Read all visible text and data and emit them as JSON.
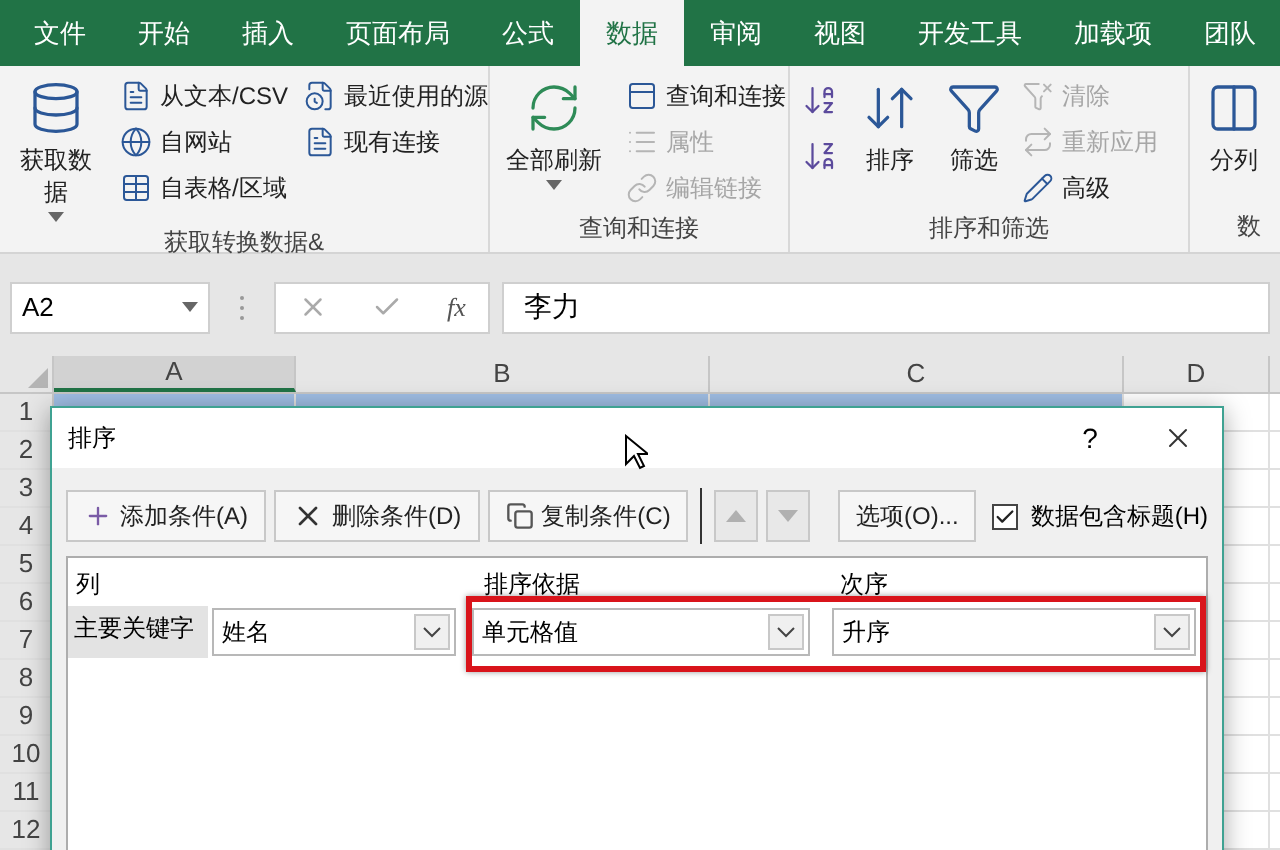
{
  "tabs": [
    {
      "label": "文件",
      "selected": false
    },
    {
      "label": "开始",
      "selected": false
    },
    {
      "label": "插入",
      "selected": false
    },
    {
      "label": "页面布局",
      "selected": false
    },
    {
      "label": "公式",
      "selected": false
    },
    {
      "label": "数据",
      "selected": true
    },
    {
      "label": "审阅",
      "selected": false
    },
    {
      "label": "视图",
      "selected": false
    },
    {
      "label": "开发工具",
      "selected": false
    },
    {
      "label": "加载项",
      "selected": false
    },
    {
      "label": "团队",
      "selected": false
    }
  ],
  "ribbon": {
    "groups": [
      {
        "label": "获取转换数据&",
        "columns": [
          [
            {
              "kind": "large",
              "label": "获取数据",
              "dropdown": true,
              "disabled": false
            }
          ],
          [
            {
              "kind": "small",
              "label": "从文本/CSV",
              "disabled": false
            },
            {
              "kind": "small",
              "label": "自网站",
              "disabled": false
            },
            {
              "kind": "small",
              "label": "自表格/区域",
              "disabled": false
            }
          ],
          [
            {
              "kind": "small",
              "label": "最近使用的源",
              "disabled": false
            },
            {
              "kind": "small",
              "label": "现有连接",
              "disabled": false
            }
          ]
        ]
      },
      {
        "label": "查询和连接",
        "columns": [
          [
            {
              "kind": "large",
              "label": "全部刷新",
              "dropdown": true,
              "disabled": false
            }
          ],
          [
            {
              "kind": "small",
              "label": "查询和连接",
              "disabled": false
            },
            {
              "kind": "small",
              "label": "属性",
              "disabled": true
            },
            {
              "kind": "small",
              "label": "编辑链接",
              "disabled": true
            }
          ]
        ]
      },
      {
        "label": "排序和筛选",
        "columns": [
          [
            {
              "kind": "icon",
              "disabled": false
            },
            {
              "kind": "icon",
              "disabled": false
            }
          ],
          [
            {
              "kind": "large",
              "label": "排序",
              "dropdown": false,
              "disabled": false
            }
          ],
          [
            {
              "kind": "large",
              "label": "筛选",
              "dropdown": false,
              "disabled": false
            }
          ],
          [
            {
              "kind": "small",
              "label": "清除",
              "disabled": true
            },
            {
              "kind": "small",
              "label": "重新应用",
              "disabled": true
            },
            {
              "kind": "small",
              "label": "高级",
              "disabled": false
            }
          ]
        ]
      },
      {
        "label": "数",
        "columns": [
          [
            {
              "kind": "large",
              "label": "分列",
              "dropdown": false,
              "disabled": false
            }
          ]
        ]
      }
    ]
  },
  "formula_bar": {
    "name_box": "A2",
    "function_label": "fx",
    "value": "李力"
  },
  "sheet": {
    "columns": [
      {
        "label": "A",
        "selected": true
      },
      {
        "label": "B",
        "selected": false
      },
      {
        "label": "C",
        "selected": false
      },
      {
        "label": "D",
        "selected": false
      }
    ],
    "rows": [
      "1",
      "2",
      "3",
      "4",
      "5",
      "6",
      "7",
      "8",
      "9",
      "10",
      "11",
      "12"
    ]
  },
  "dialog": {
    "title": "排序",
    "help": "?",
    "toolbar": [
      {
        "kind": "add",
        "label": "添加条件(A)"
      },
      {
        "kind": "delete",
        "label": "删除条件(D)"
      },
      {
        "kind": "copy",
        "label": "复制条件(C)"
      },
      {
        "kind": "up",
        "disabled": true
      },
      {
        "kind": "down",
        "disabled": true
      },
      {
        "kind": "text",
        "label": "选项(O)..."
      }
    ],
    "has_headers": {
      "label": "数据包含标题(H)",
      "checked": true
    },
    "columns": [
      "列",
      "排序依据",
      "次序"
    ],
    "levels": [
      {
        "label": "主要关键字",
        "column": "姓名",
        "sort_on": "单元格值",
        "order": "升序",
        "highlighted": true
      }
    ]
  }
}
